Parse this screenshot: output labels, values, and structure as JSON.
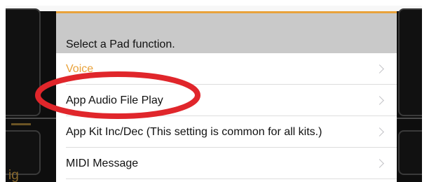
{
  "popover": {
    "header": "Select a Pad function.",
    "accent_color": "#e9a23b",
    "items": [
      {
        "label": "Voice",
        "selected": true
      },
      {
        "label": "App Audio File Play",
        "selected": false
      },
      {
        "label": "App Kit Inc/Dec (This setting is common for all kits.)",
        "selected": false
      },
      {
        "label": "MIDI Message",
        "selected": false
      }
    ]
  },
  "background": {
    "partial_text": "ig"
  },
  "annotation": {
    "type": "ellipse",
    "color": "#e0262b",
    "target": "App Audio File Play"
  },
  "icons": {
    "row_chevron": "chevron-right-icon"
  }
}
